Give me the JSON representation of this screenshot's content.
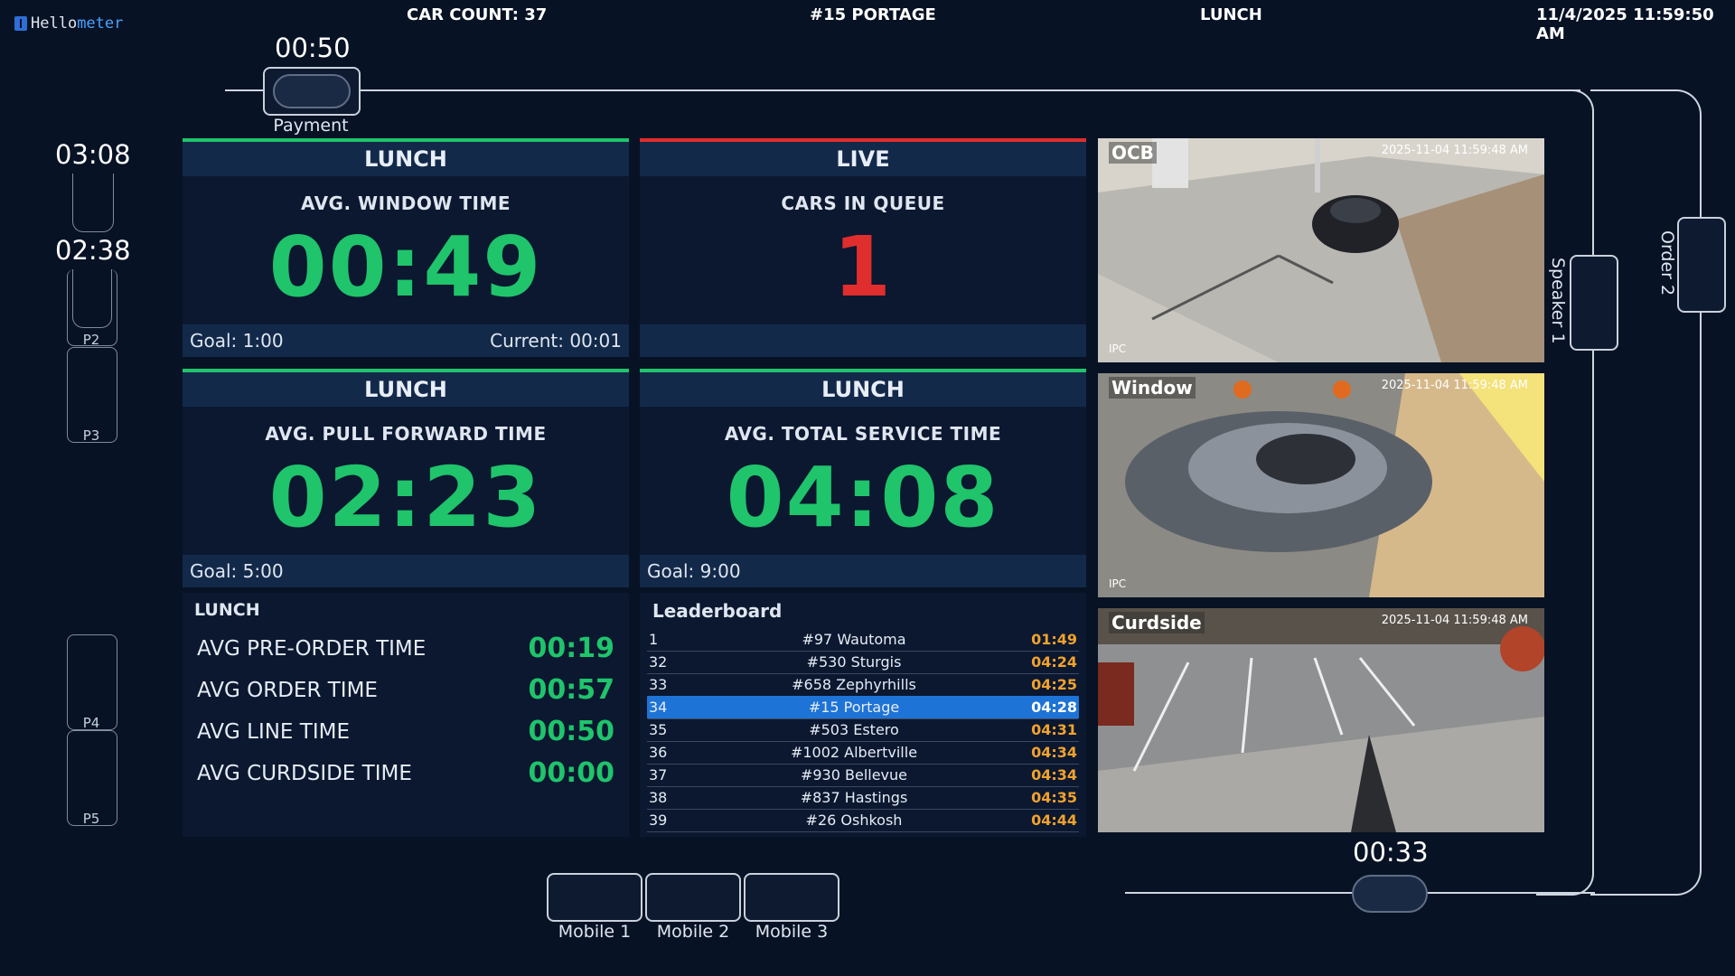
{
  "header": {
    "logo_prefix": "Hello",
    "logo_suffix": "meter",
    "car_count": "CAR COUNT: 37",
    "store": "#15 PORTAGE",
    "daypart": "LUNCH",
    "datetime": "11/4/2025 11:59:50 AM"
  },
  "track": {
    "payment": {
      "label": "Payment",
      "timer": "00:50"
    },
    "left_timers": [
      "03:08",
      "02:38"
    ],
    "slots": [
      "P2",
      "P3",
      "P4",
      "P5"
    ],
    "mobile": [
      "Mobile 1",
      "Mobile 2",
      "Mobile 3"
    ],
    "bottom_timer": "00:33",
    "speaker": "Speaker 1",
    "order": "Order 2"
  },
  "panels": {
    "window": {
      "head": "LUNCH",
      "sub": "AVG. WINDOW TIME",
      "value": "00:49",
      "goal": "Goal: 1:00",
      "current": "Current: 00:01",
      "bar_color": "#1fc46b"
    },
    "live": {
      "head": "LIVE",
      "sub": "CARS IN QUEUE",
      "value": "1",
      "bar_color": "#e02d2d"
    },
    "pull": {
      "head": "LUNCH",
      "sub": "AVG. PULL FORWARD TIME",
      "value": "02:23",
      "goal": "Goal: 5:00",
      "bar_color": "#1fc46b"
    },
    "total": {
      "head": "LUNCH",
      "sub": "AVG. TOTAL SERVICE TIME",
      "value": "04:08",
      "goal": "Goal: 9:00",
      "bar_color": "#1fc46b"
    }
  },
  "averages": {
    "title": "LUNCH",
    "rows": [
      {
        "label": "AVG PRE-ORDER TIME",
        "value": "00:19"
      },
      {
        "label": "AVG ORDER TIME",
        "value": "00:57"
      },
      {
        "label": "AVG LINE TIME",
        "value": "00:50"
      },
      {
        "label": "AVG CURDSIDE TIME",
        "value": "00:00"
      }
    ]
  },
  "leaderboard": {
    "title": "Leaderboard",
    "rows": [
      {
        "rank": "1",
        "name": "#97 Wautoma",
        "time": "01:49"
      },
      {
        "rank": "32",
        "name": "#530 Sturgis",
        "time": "04:24"
      },
      {
        "rank": "33",
        "name": "#658 Zephyrhills",
        "time": "04:25"
      },
      {
        "rank": "34",
        "name": "#15 Portage",
        "time": "04:28",
        "highlight": true
      },
      {
        "rank": "35",
        "name": "#503 Estero",
        "time": "04:31"
      },
      {
        "rank": "36",
        "name": "#1002 Albertville",
        "time": "04:34"
      },
      {
        "rank": "37",
        "name": "#930 Bellevue",
        "time": "04:34"
      },
      {
        "rank": "38",
        "name": "#837 Hastings",
        "time": "04:35"
      },
      {
        "rank": "39",
        "name": "#26 Oshkosh",
        "time": "04:44"
      }
    ]
  },
  "cameras": [
    {
      "label": "OCB",
      "timestamp": "2025-11-04 11:59:48 AM",
      "ipc": "IPC"
    },
    {
      "label": "Window",
      "timestamp": "2025-11-04 11:59:48 AM",
      "ipc": "IPC"
    },
    {
      "label": "Curdside",
      "timestamp": "2025-11-04 11:59:48 AM",
      "ipc": ""
    }
  ]
}
